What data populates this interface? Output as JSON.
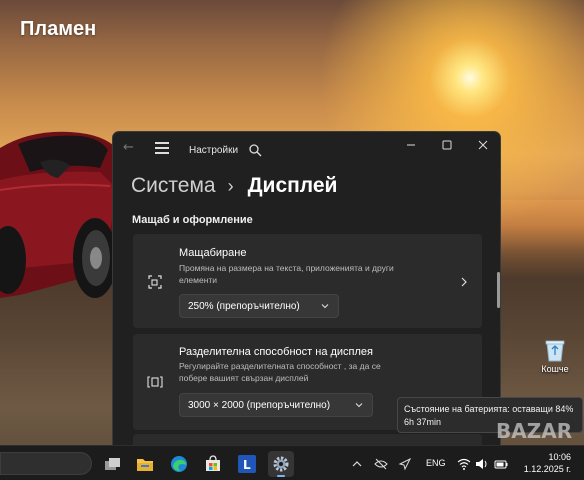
{
  "desktop": {
    "user_name": "Пламен",
    "recycle_bin_label": "Кошче"
  },
  "window": {
    "title": "Настройки",
    "breadcrumb_parent": "Система",
    "breadcrumb_current": "Дисплей",
    "section_title": "Мащаб и оформление",
    "scale": {
      "title": "Мащабиране",
      "description": "Промяна на размера на текста, приложенията и други елементи",
      "value": "250% (препоръчително)"
    },
    "resolution": {
      "title": "Разделителна способност на дисплея",
      "description": "Регулирайте разделителната способност , за да се побере вашият свързан дисплей",
      "value": "3000 × 2000 (препоръчително)"
    }
  },
  "tooltip": {
    "text": "Състояние на батерията: оставащи 84% 6h 37min"
  },
  "taskbar": {
    "language": "ENG",
    "time": "10:06",
    "date": "1.12.2025 г.",
    "apps": [
      "task-view-icon",
      "file-explorer-icon",
      "edge-icon",
      "store-icon",
      "l-app-icon",
      "settings-icon"
    ]
  },
  "watermark": "BAZAR",
  "colors": {
    "window_bg": "#202020",
    "card_bg": "#2b2b2b",
    "accent": "#7fb3e8",
    "taskbar_bg": "#1c1c1c"
  }
}
